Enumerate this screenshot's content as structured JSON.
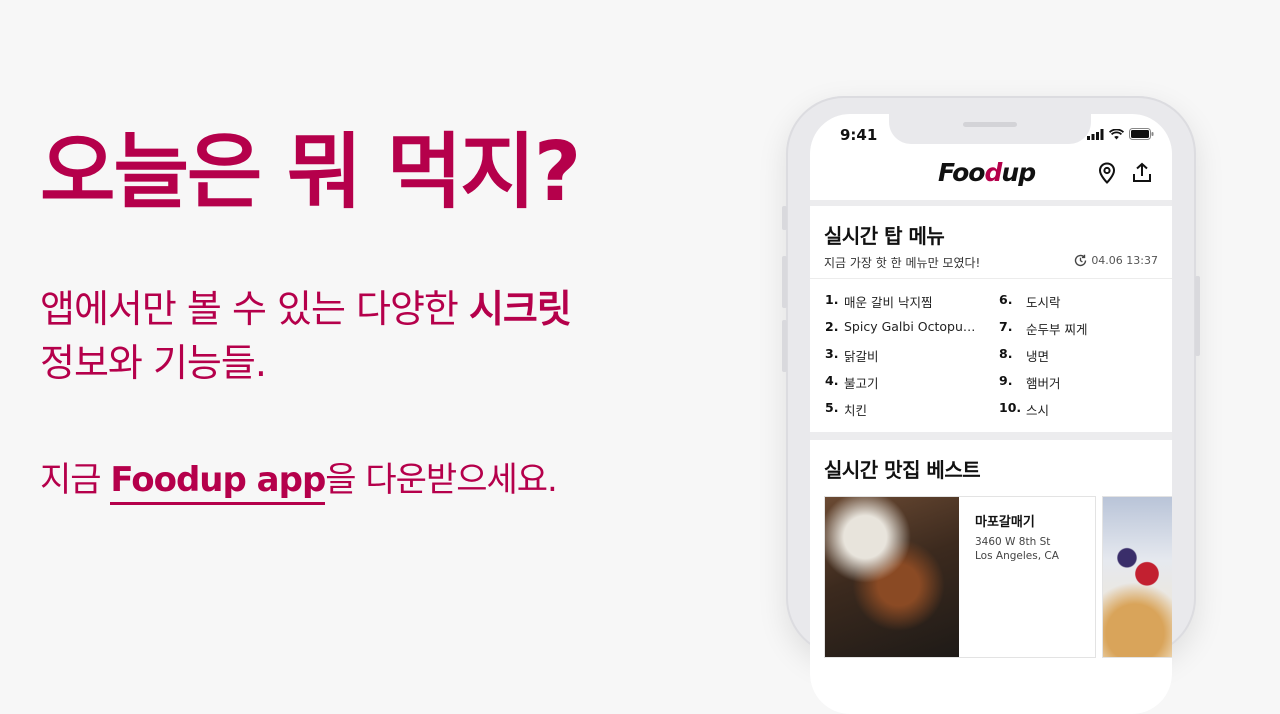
{
  "hero": {
    "headline": "오늘은 뭐 먹지?",
    "subline_regular": "앱에서만 볼 수 있는 다양한 ",
    "subline_bold": "시크릿",
    "subline_line2": "정보와 기능들.",
    "cta_prefix": "지금 ",
    "cta_link": "Foodup app",
    "cta_suffix": "을 다운받으세요."
  },
  "phone": {
    "status_time": "9:41",
    "app_name_start": "Foo",
    "app_name_mark": "d",
    "app_name_end": "up",
    "top_menu": {
      "title": "실시간 탑 메뉴",
      "subtitle": "지금 가장 핫 한 메뉴만 모였다!",
      "updated": "04.06 13:37",
      "items": [
        {
          "rank": "1.",
          "name": "매운 갈비 낙지찜"
        },
        {
          "rank": "2.",
          "name": "Spicy Galbi Octopus P..."
        },
        {
          "rank": "3.",
          "name": "닭갈비"
        },
        {
          "rank": "4.",
          "name": "불고기"
        },
        {
          "rank": "5.",
          "name": "치킨"
        },
        {
          "rank": "6.",
          "name": "도시락"
        },
        {
          "rank": "7.",
          "name": "순두부 찌게"
        },
        {
          "rank": "8.",
          "name": "냉면"
        },
        {
          "rank": "9.",
          "name": "햄버거"
        },
        {
          "rank": "10.",
          "name": "스시"
        }
      ]
    },
    "best_restaurants": {
      "title": "실시간 맛집 베스트",
      "restaurants": [
        {
          "name": "마포갈매기",
          "address_line1": "3460 W 8th St",
          "address_line2": "Los Angeles, CA"
        }
      ]
    }
  },
  "colors": {
    "brand": "#b5004b",
    "background": "#f7f7f7"
  },
  "icons": [
    "signal-icon",
    "wifi-icon",
    "battery-icon",
    "location-pin-icon",
    "share-icon",
    "clock-refresh-icon"
  ]
}
